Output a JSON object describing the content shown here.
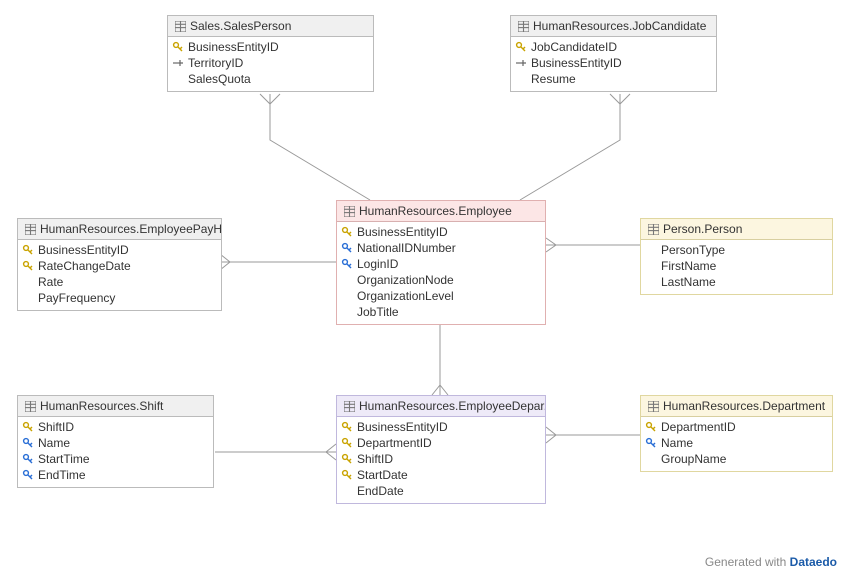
{
  "footer": {
    "generated": "Generated with",
    "brand": "Dataedo"
  },
  "tables": {
    "salesPerson": {
      "title": "Sales.SalesPerson",
      "cols": [
        {
          "icon": "key",
          "name": "BusinessEntityID"
        },
        {
          "icon": "fk",
          "name": "TerritoryID"
        },
        {
          "icon": "none",
          "name": "SalesQuota"
        }
      ]
    },
    "jobCandidate": {
      "title": "HumanResources.JobCandidate",
      "cols": [
        {
          "icon": "key",
          "name": "JobCandidateID"
        },
        {
          "icon": "fk",
          "name": "BusinessEntityID"
        },
        {
          "icon": "none",
          "name": "Resume"
        }
      ]
    },
    "payHistory": {
      "title": "HumanResources.EmployeePayHi...",
      "cols": [
        {
          "icon": "key",
          "name": "BusinessEntityID"
        },
        {
          "icon": "key",
          "name": "RateChangeDate"
        },
        {
          "icon": "none",
          "name": "Rate"
        },
        {
          "icon": "none",
          "name": "PayFrequency"
        }
      ]
    },
    "employee": {
      "title": "HumanResources.Employee",
      "cols": [
        {
          "icon": "key",
          "name": "BusinessEntityID"
        },
        {
          "icon": "blue",
          "name": "NationalIDNumber"
        },
        {
          "icon": "blue",
          "name": "LoginID"
        },
        {
          "icon": "none",
          "name": "OrganizationNode"
        },
        {
          "icon": "none",
          "name": "OrganizationLevel"
        },
        {
          "icon": "none",
          "name": "JobTitle"
        }
      ]
    },
    "person": {
      "title": "Person.Person",
      "cols": [
        {
          "icon": "none",
          "name": "PersonType"
        },
        {
          "icon": "none",
          "name": "FirstName"
        },
        {
          "icon": "none",
          "name": "LastName"
        }
      ]
    },
    "shift": {
      "title": "HumanResources.Shift",
      "cols": [
        {
          "icon": "key",
          "name": "ShiftID"
        },
        {
          "icon": "blue",
          "name": "Name"
        },
        {
          "icon": "blue",
          "name": "StartTime"
        },
        {
          "icon": "blue",
          "name": "EndTime"
        }
      ]
    },
    "empDeptHist": {
      "title": "HumanResources.EmployeeDepar...",
      "cols": [
        {
          "icon": "key",
          "name": "BusinessEntityID"
        },
        {
          "icon": "key",
          "name": "DepartmentID"
        },
        {
          "icon": "key",
          "name": "ShiftID"
        },
        {
          "icon": "key",
          "name": "StartDate"
        },
        {
          "icon": "none",
          "name": "EndDate"
        }
      ]
    },
    "department": {
      "title": "HumanResources.Department",
      "cols": [
        {
          "icon": "key",
          "name": "DepartmentID"
        },
        {
          "icon": "blue",
          "name": "Name"
        },
        {
          "icon": "none",
          "name": "GroupName"
        }
      ]
    }
  }
}
